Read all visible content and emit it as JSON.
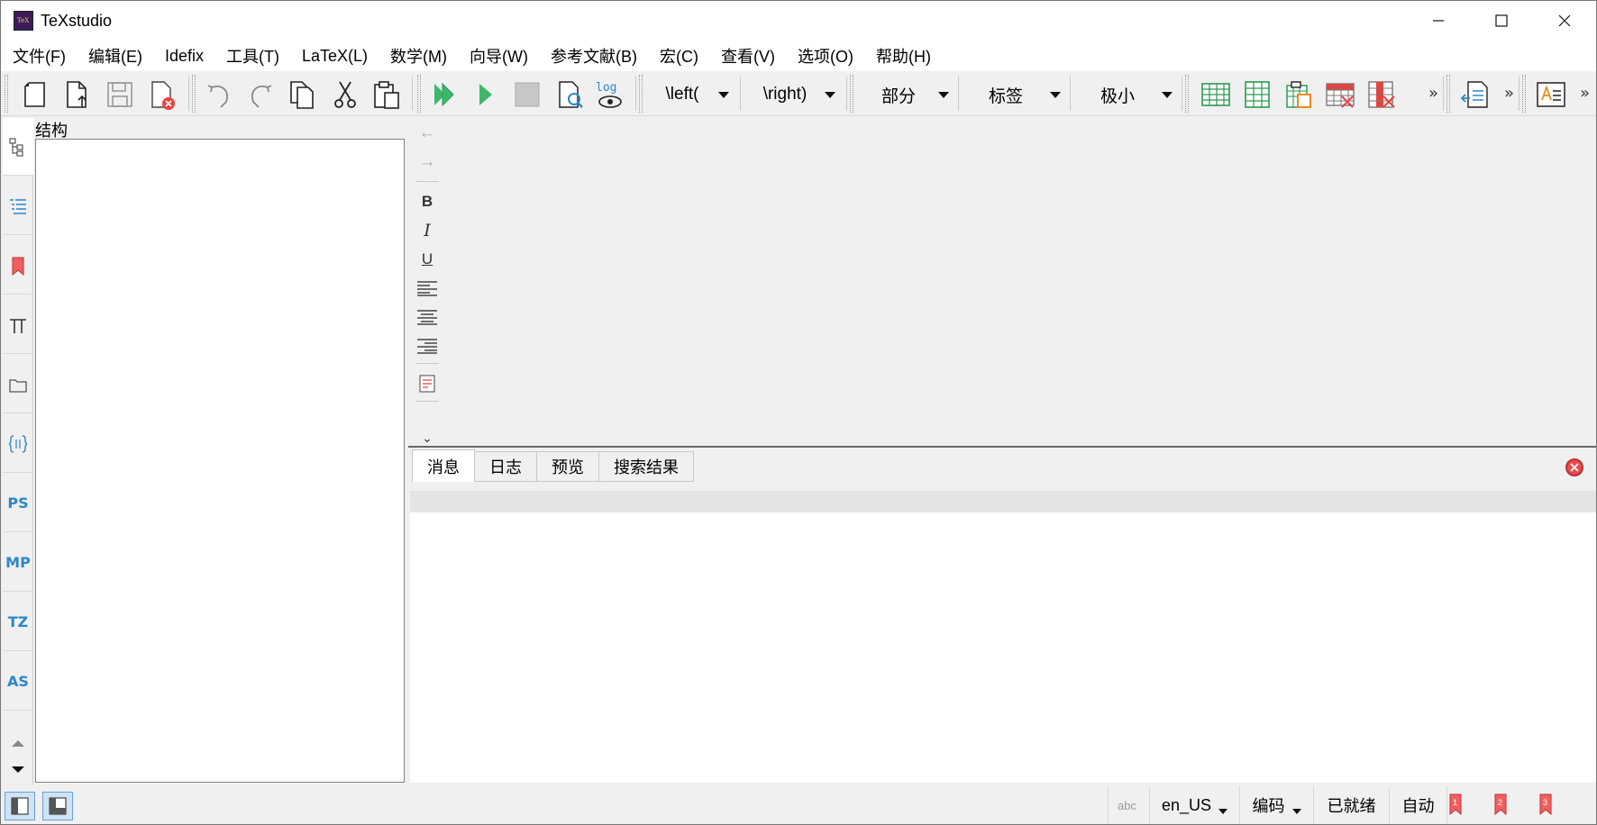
{
  "window": {
    "title": "TeXstudio",
    "minimize": "—",
    "maximize": "☐",
    "close": "✕"
  },
  "menu": [
    "文件(F)",
    "编辑(E)",
    "Idefix",
    "工具(T)",
    "LaTeX(L)",
    "数学(M)",
    "向导(W)",
    "参考文献(B)",
    "宏(C)",
    "查看(V)",
    "选项(O)",
    "帮助(H)"
  ],
  "toolbar": {
    "log_label": "log",
    "combos": [
      {
        "label": "\\left("
      },
      {
        "label": "\\right)"
      },
      {
        "label": "部分"
      },
      {
        "label": "标签"
      },
      {
        "label": "极小"
      }
    ],
    "overflow": "»"
  },
  "sidebar": {
    "tabs": [
      "structure",
      "toc",
      "bookmarks",
      "symbols",
      "files",
      "braces",
      "PS",
      "MP",
      "TZ",
      "AS"
    ],
    "text_tabs": {
      "ps": "PS",
      "mp": "MP",
      "tz": "TZ",
      "as": "AS"
    }
  },
  "structure_panel": {
    "title": "结构"
  },
  "edit_toolbar": {
    "back": "←",
    "forward": "→",
    "bold": "B",
    "italic": "I",
    "underline": "U",
    "more": "⌄"
  },
  "messages": {
    "tabs": [
      "消息",
      "日志",
      "预览",
      "搜索结果"
    ],
    "active_tab": "消息"
  },
  "statusbar": {
    "spell_icon_text": "abc",
    "language": "en_US",
    "encoding": "编码",
    "status": "已就绪",
    "mode": "自动",
    "bookmarks": [
      "1",
      "2",
      "3"
    ]
  }
}
